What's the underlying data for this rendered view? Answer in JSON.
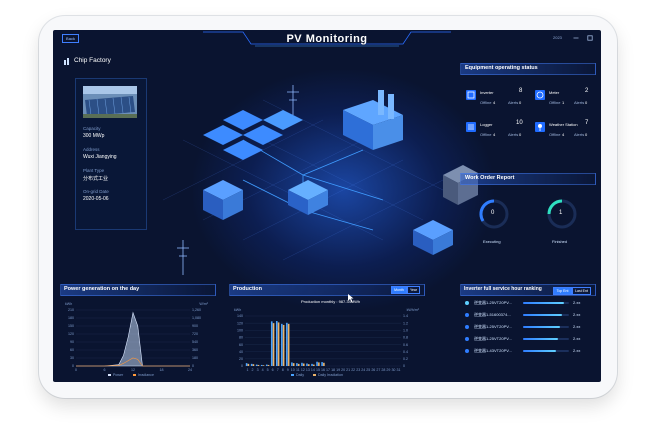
{
  "header": {
    "title": "PV Monitoring",
    "back_label": "Back",
    "clock": "2023"
  },
  "site": {
    "name": "Chip Factory",
    "capacity_label": "Capacity",
    "capacity_value": "300 MWp",
    "address_label": "Address",
    "address_value": "Wuxi Jiangying",
    "plant_type_label": "Plant Type",
    "plant_type_value": "分布式工业",
    "ongrid_label": "On-grid Date",
    "ongrid_value": "2020-05-06"
  },
  "equipment": {
    "title": "Equipment operating status",
    "items": [
      {
        "name": "Inverter",
        "count": "8",
        "offline_label": "Offline",
        "offline": "4",
        "alerts_label": "Alerts",
        "alerts": "0",
        "icon": "inverter-icon"
      },
      {
        "name": "Meter",
        "count": "2",
        "offline_label": "Offline",
        "offline": "1",
        "alerts_label": "Alerts",
        "alerts": "0",
        "icon": "meter-icon"
      },
      {
        "name": "Logger",
        "count": "10",
        "offline_label": "Offline",
        "offline": "4",
        "alerts_label": "Alerts",
        "alerts": "0",
        "icon": "logger-icon"
      },
      {
        "name": "Weather Station",
        "count": "7",
        "offline_label": "Offline",
        "offline": "4",
        "alerts_label": "Alerts",
        "alerts": "0",
        "icon": "weather-station-icon"
      }
    ]
  },
  "work_order": {
    "title": "Work Order Report",
    "executing_label": "Executing",
    "executing_value": "0",
    "finished_label": "Finished",
    "finished_value": "1"
  },
  "power_day": {
    "title": "Power generation on the day",
    "unit_left": "kWh",
    "unit_right": "W/m²",
    "y_left": [
      "210",
      "180",
      "150",
      "120",
      "90",
      "60",
      "30",
      "0"
    ],
    "y_right": [
      "1,260",
      "1,080",
      "900",
      "720",
      "540",
      "360",
      "180",
      "0"
    ],
    "x": [
      "0",
      "6",
      "12",
      "18",
      "24"
    ],
    "legend_power": "Power",
    "legend_irradiance": "Irradiance"
  },
  "production": {
    "title": "Production",
    "btn_month": "Month",
    "btn_year": "Year",
    "summary": "Production monthly : 987.34MWh",
    "unit_left": "kWh",
    "unit_right": "kWh/m²",
    "y_left": [
      "140",
      "120",
      "100",
      "80",
      "60",
      "40",
      "20",
      "0"
    ],
    "y_right": [
      "1.4",
      "1.2",
      "1.0",
      "0.8",
      "0.6",
      "0.4",
      "0.2",
      "0"
    ],
    "legend_daily": "Daily",
    "legend_irr": "Daily Irradiation"
  },
  "ranking": {
    "title": "Inverter full service hour ranking",
    "btn_top": "Top Ent",
    "btn_last": "Last Ent",
    "items": [
      {
        "name": "逆变器1-25VT20PV...",
        "value": "2.xx",
        "fill": 0.9
      },
      {
        "name": "逆变器1-51600374...",
        "value": "2.xx",
        "fill": 0.84
      },
      {
        "name": "逆变器1-25VT20PV...",
        "value": "2.xx",
        "fill": 0.8
      },
      {
        "name": "逆变器1-25VT20PV...",
        "value": "2.xx",
        "fill": 0.76
      },
      {
        "name": "逆变器1-43VT20PV...",
        "value": "2.xx",
        "fill": 0.72
      }
    ]
  },
  "chart_data": [
    {
      "type": "area",
      "title": "Power generation on the day",
      "xlabel": "",
      "ylabel": "kWh",
      "x": [
        0,
        6,
        9,
        10,
        11,
        12,
        13,
        14,
        18,
        24
      ],
      "series": [
        {
          "name": "Power",
          "values": [
            0,
            0,
            5,
            40,
            110,
            200,
            150,
            0,
            0,
            0
          ]
        },
        {
          "name": "Irradiance",
          "values": [
            0,
            0,
            2,
            10,
            20,
            30,
            25,
            0,
            0,
            0
          ]
        }
      ],
      "ylim": [
        0,
        210
      ]
    },
    {
      "type": "bar",
      "title": "Production",
      "xlabel": "",
      "ylabel": "kWh",
      "categories": [
        "1",
        "2",
        "3",
        "4",
        "5",
        "6",
        "7",
        "8",
        "9",
        "10",
        "11",
        "12",
        "13",
        "14",
        "15",
        "16",
        "17",
        "18",
        "19",
        "20",
        "21",
        "22",
        "23",
        "24",
        "25",
        "26",
        "27",
        "28",
        "29",
        "30",
        "31"
      ],
      "series": [
        {
          "name": "Daily",
          "values": [
            8,
            6,
            4,
            3,
            4,
            125,
            126,
            118,
            121,
            10,
            8,
            9,
            7,
            6,
            12,
            11,
            0,
            0,
            0,
            0,
            0,
            0,
            0,
            0,
            0,
            0,
            0,
            0,
            0,
            0,
            0
          ]
        },
        {
          "name": "Daily Irradiation",
          "values": [
            6,
            5,
            3,
            2,
            3,
            120,
            122,
            115,
            118,
            8,
            6,
            7,
            5,
            4,
            10,
            9,
            0,
            0,
            0,
            0,
            0,
            0,
            0,
            0,
            0,
            0,
            0,
            0,
            0,
            0,
            0
          ]
        }
      ],
      "ylim": [
        0,
        140
      ]
    }
  ]
}
